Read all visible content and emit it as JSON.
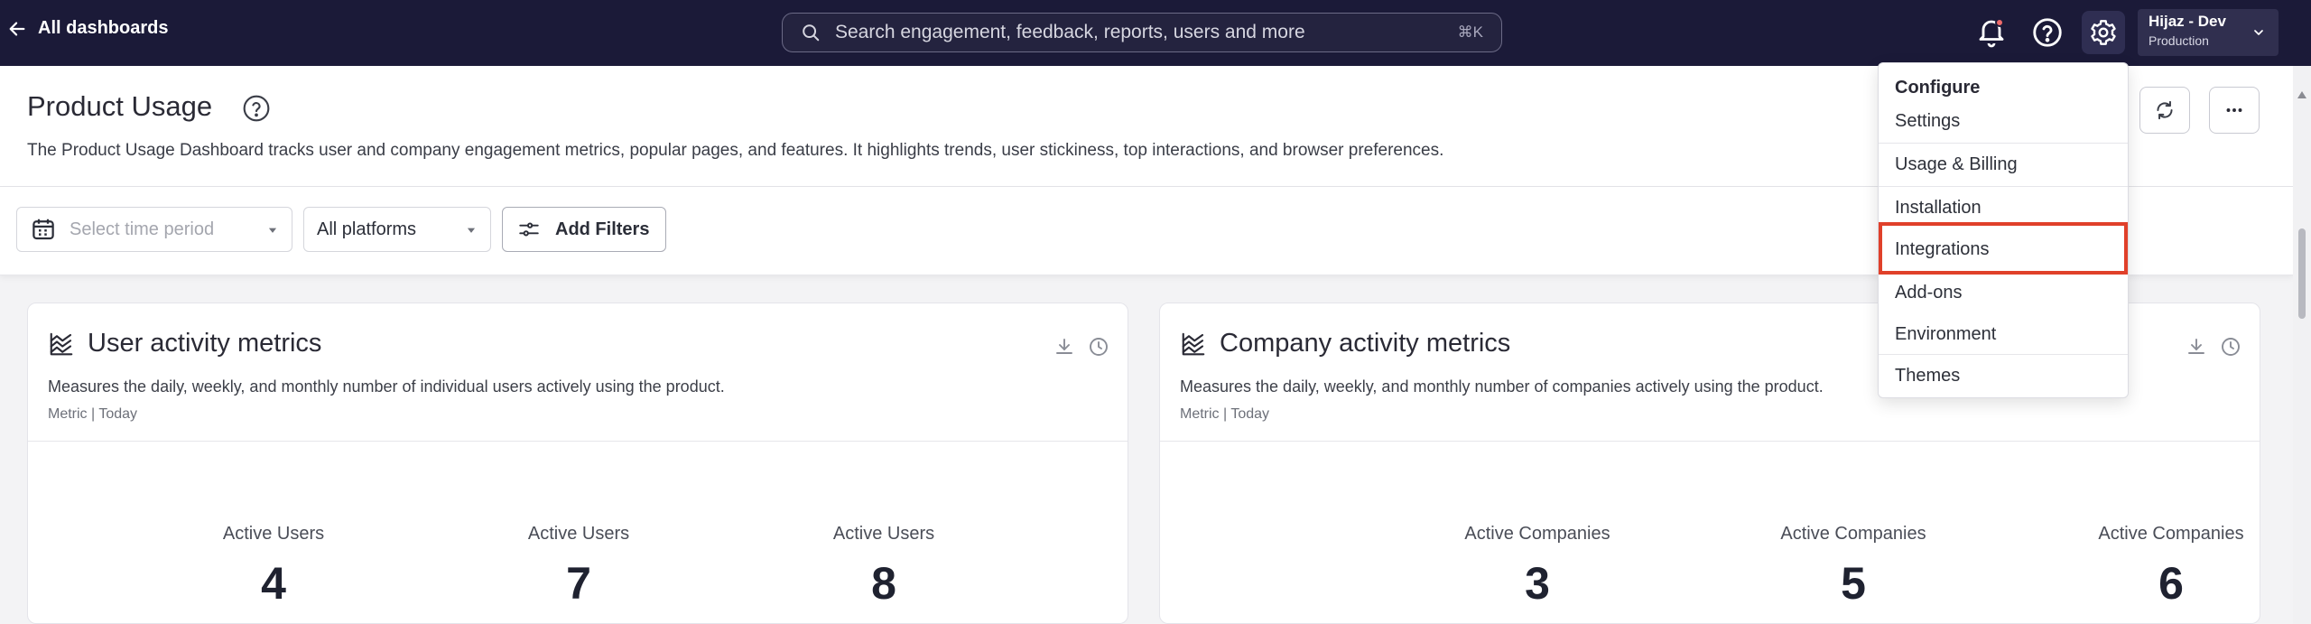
{
  "topbar": {
    "back_label": "All dashboards",
    "search_placeholder": "Search engagement, feedback, reports, users and more",
    "search_shortcut": "⌘K",
    "user": {
      "name": "Hijaz - Dev",
      "environment": "Production"
    }
  },
  "header": {
    "title": "Product Usage",
    "description": "The Product Usage Dashboard tracks user and company engagement metrics, popular pages, and features. It highlights trends, user stickiness, top interactions, and browser preferences."
  },
  "filters": {
    "time_placeholder": "Select time period",
    "platform_value": "All platforms",
    "add_filters_label": "Add Filters"
  },
  "cards": [
    {
      "title": "User activity metrics",
      "description": "Measures the daily, weekly, and monthly number of individual users actively using the product.",
      "meta": "Metric | Today",
      "metrics": [
        {
          "label": "Active Users",
          "value": "4"
        },
        {
          "label": "Active Users",
          "value": "7"
        },
        {
          "label": "Active Users",
          "value": "8"
        }
      ]
    },
    {
      "title": "Company activity metrics",
      "description": "Measures the daily, weekly, and monthly number of companies actively using the product.",
      "meta": "Metric | Today",
      "metrics": [
        {
          "label": "Active Companies",
          "value": "3"
        },
        {
          "label": "Active Companies",
          "value": "5"
        },
        {
          "label": "Active Companies",
          "value": "6"
        }
      ]
    }
  ],
  "configure_menu": {
    "heading": "Configure",
    "items": [
      "Settings",
      "Usage & Billing",
      "Installation",
      "Integrations",
      "Add-ons",
      "Environment",
      "Themes"
    ],
    "highlighted": "Integrations"
  },
  "colors": {
    "topbar_bg": "#1b1a38",
    "highlight": "#e0402a",
    "notification_dot": "#ef6a6a"
  }
}
